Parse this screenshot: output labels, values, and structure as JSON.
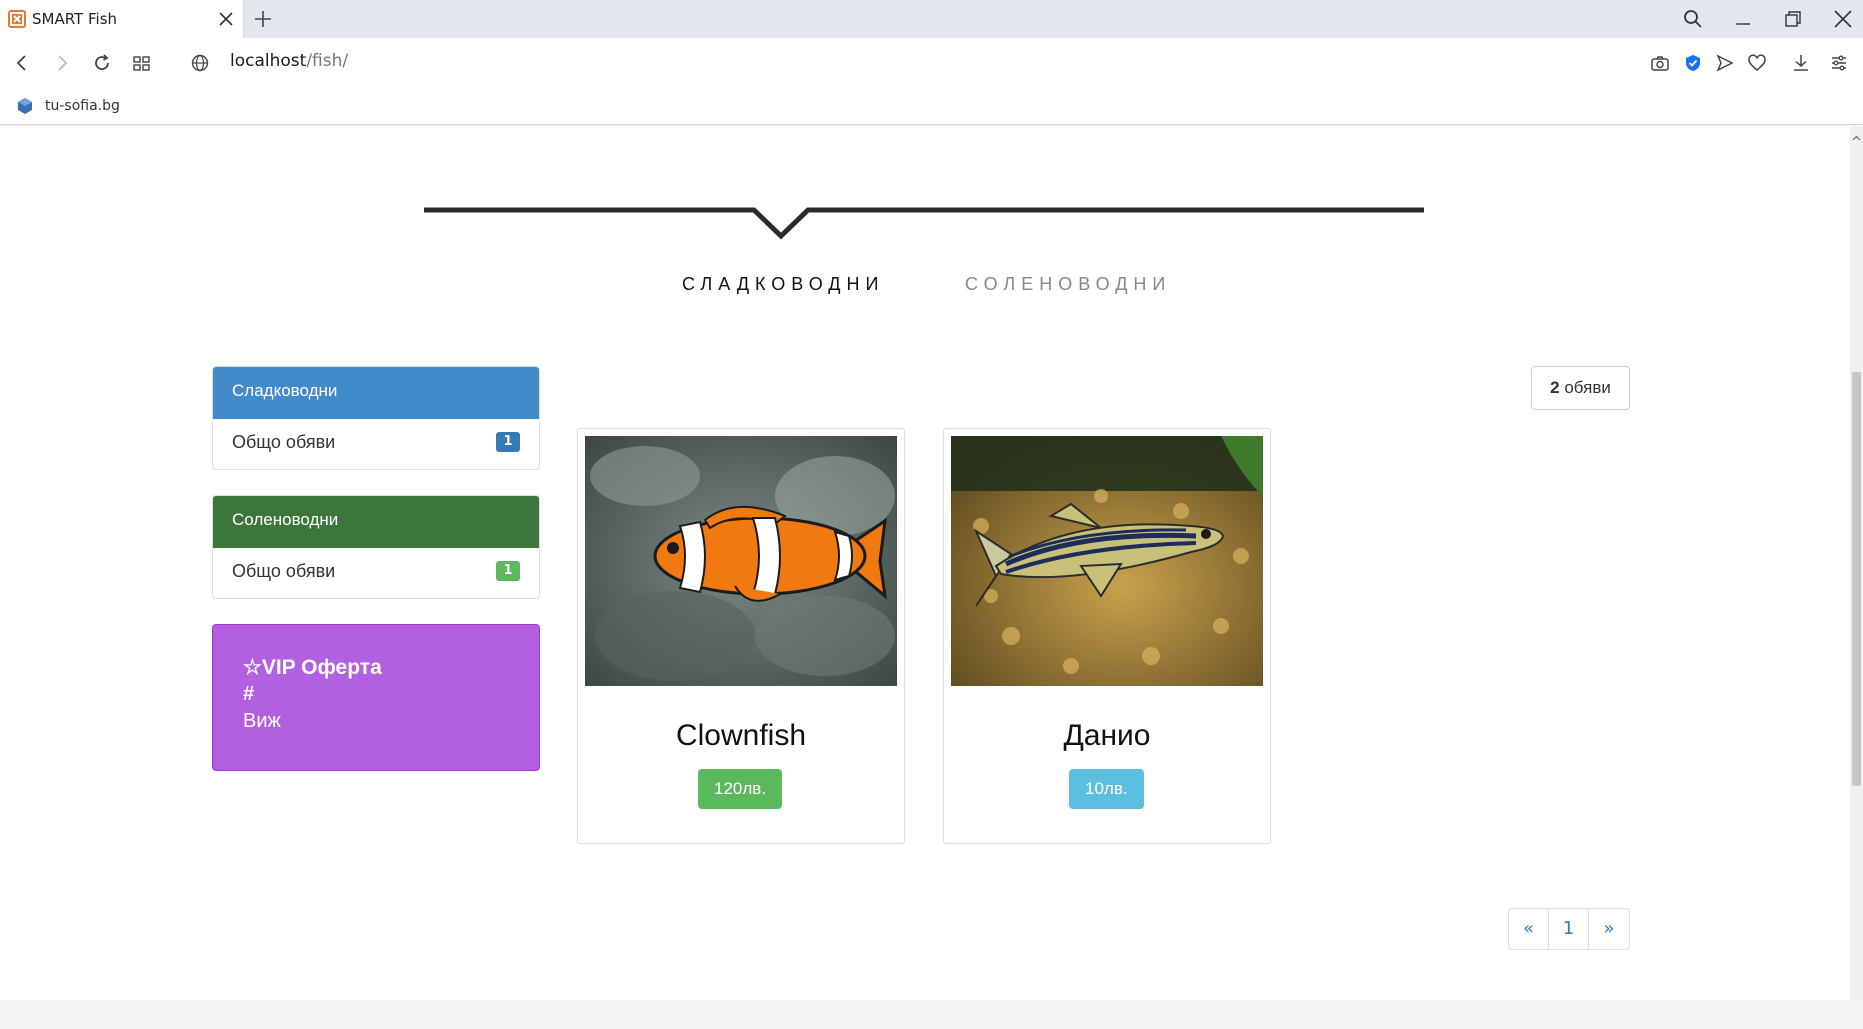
{
  "browser": {
    "tab_title": "SMART Fish",
    "url_host": "localhost",
    "url_path": "/fish/",
    "bookmark": "tu-sofia.bg"
  },
  "filters": {
    "freshwater": "СЛАДКОВОДНИ",
    "saltwater": "СОЛЕНОВОДНИ"
  },
  "sidebar": {
    "freshwater": {
      "title": "Сладководни",
      "label": "Общо обяви",
      "count": "1",
      "color": "#428bca",
      "badge_color": "#337ab7"
    },
    "saltwater": {
      "title": "Соленоводни",
      "label": "Общо обяви",
      "count": "1",
      "color": "#3c763d",
      "badge_color": "#5cb85c"
    },
    "vip": {
      "title": "☆VIP Оферта",
      "hash": "#",
      "link": "Виж",
      "color": "#b260e0"
    }
  },
  "results": {
    "count": "2",
    "count_label": " обяви"
  },
  "listings": [
    {
      "name": "Clownfish",
      "price": "120лв.",
      "price_color": "#5cb85c"
    },
    {
      "name": "Данио",
      "price": "10лв.",
      "price_color": "#5bc0de"
    }
  ],
  "pagination": {
    "prev": "«",
    "page": "1",
    "next": "»"
  }
}
